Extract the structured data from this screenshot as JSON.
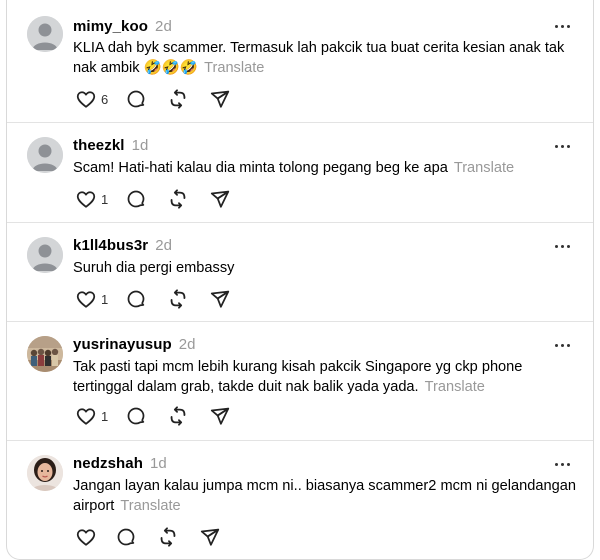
{
  "replies": [
    {
      "username": "mimy_koo",
      "time": "2d",
      "text": "KLIA dah byk scammer. Termasuk lah pakcik tua buat cerita kesian anak tak nak ambik 🤣🤣🤣",
      "translate": "Translate",
      "likes": "6",
      "avatar": "default-avatar-icon"
    },
    {
      "username": "theezkl",
      "time": "1d",
      "text": "Scam! Hati-hati kalau dia minta tolong pegang beg ke apa",
      "translate": "Translate",
      "likes": "1",
      "avatar": "default-avatar-icon"
    },
    {
      "username": "k1ll4bus3r",
      "time": "2d",
      "text": "Suruh dia pergi embassy",
      "translate": "",
      "likes": "1",
      "avatar": "default-avatar-icon"
    },
    {
      "username": "yusrinayusup",
      "time": "2d",
      "text": "Tak pasti tapi mcm lebih kurang kisah pakcik Singapore yg ckp phone tertinggal dalam grab, takde duit nak balik yada yada.",
      "translate": "Translate",
      "likes": "1",
      "avatar": "group-photo-avatar"
    },
    {
      "username": "nedzshah",
      "time": "1d",
      "text": "Jangan layan kalau jumpa mcm ni.. biasanya scammer2 mcm ni gelandangan airport",
      "translate": "Translate",
      "likes": "",
      "avatar": "portrait-photo-avatar"
    }
  ],
  "icons": {
    "like": "heart-icon",
    "reply": "speech-bubble-icon",
    "repost": "repost-icon",
    "share": "send-icon",
    "more": "more-dots-icon"
  },
  "colors": {
    "muted": "#999999",
    "text": "#000000",
    "divider": "#e3e3e3"
  }
}
